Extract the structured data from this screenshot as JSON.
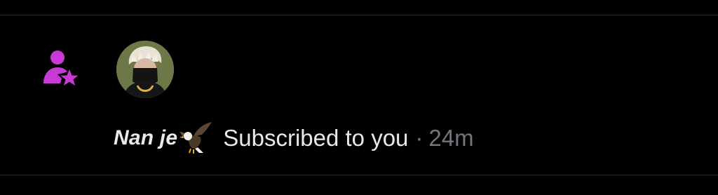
{
  "notification": {
    "type_icon": "person-star-icon",
    "avatar": "user-avatar",
    "username": "Nan je",
    "username_emoji": "eagle-emoji",
    "action_text": "Subscribed to you",
    "separator": "·",
    "time_ago": "24m"
  },
  "colors": {
    "background": "#000000",
    "accent_icon": "#c73ad6",
    "primary_text": "#e7e9ea",
    "secondary_text": "#71767b",
    "divider": "#2a2a2a"
  }
}
